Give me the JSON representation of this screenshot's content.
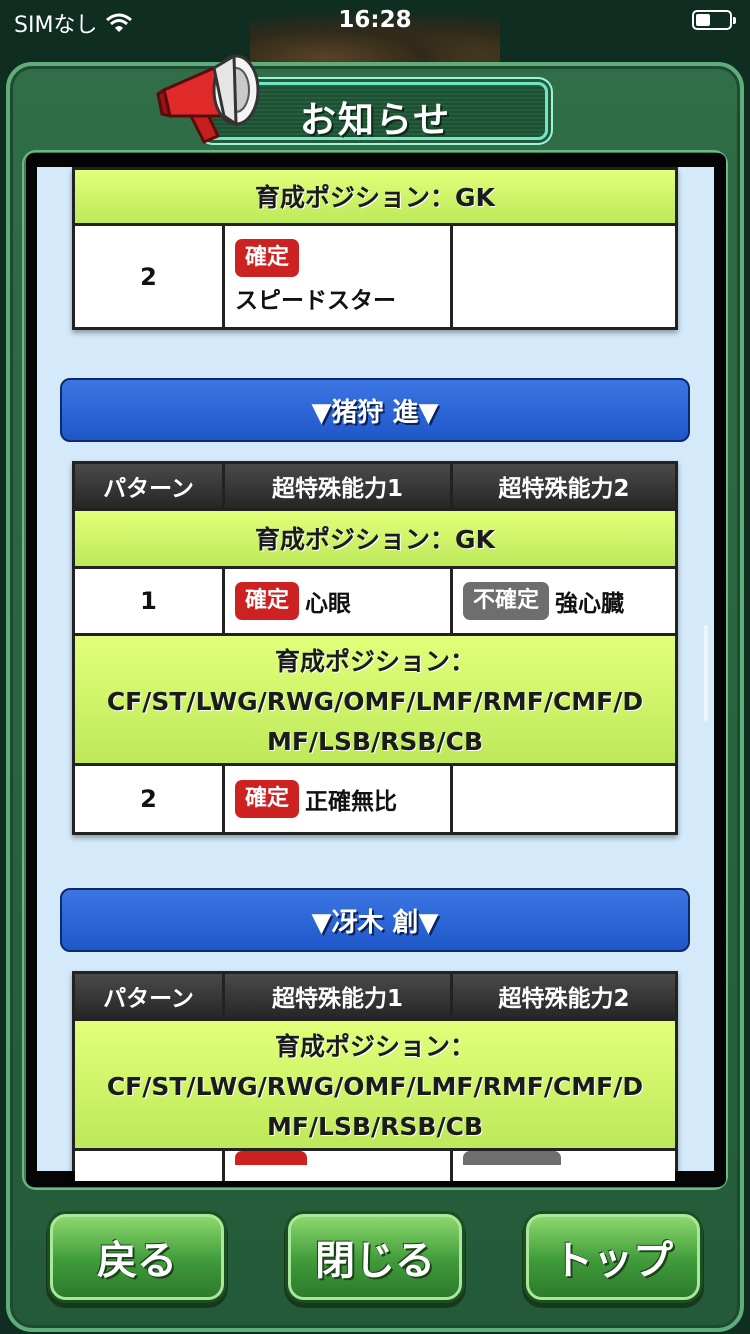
{
  "status_bar": {
    "carrier": "SIMなし",
    "time": "16:28"
  },
  "header": {
    "title": "お知らせ"
  },
  "sections": {
    "top_partial": {
      "position": "育成ポジション：GK",
      "rows": [
        {
          "pattern": "2",
          "badge1": "確定",
          "skill1": "スピードスター"
        }
      ]
    },
    "character1": {
      "name": "▼猪狩 進▼",
      "columns": [
        "パターン",
        "超特殊能力1",
        "超特殊能力2"
      ],
      "position_gk": "育成ポジション：GK",
      "row1": {
        "pattern": "1",
        "badge1": "確定",
        "skill1": "心眼",
        "badge2": "不確定",
        "skill2": "強心臓"
      },
      "position_field_lines": [
        "育成ポジション：",
        "CF/ST/LWG/RWG/OMF/LMF/RMF/CMF/D",
        "MF/LSB/RSB/CB"
      ],
      "row2": {
        "pattern": "2",
        "badge1": "確定",
        "skill1": "正確無比"
      }
    },
    "character2": {
      "name": "▼冴木 創▼",
      "columns": [
        "パターン",
        "超特殊能力1",
        "超特殊能力2"
      ],
      "position_field_lines": [
        "育成ポジション：",
        "CF/ST/LWG/RWG/OMF/LMF/RMF/CMF/D",
        "MF/LSB/RSB/CB"
      ]
    }
  },
  "buttons": {
    "back": "戻る",
    "close": "閉じる",
    "top": "トップ"
  },
  "colors": {
    "accent_green": "#3f9a3a",
    "badge_confirmed": "#cc2222",
    "badge_unconfirmed": "#6e6e6e",
    "name_bar": "#1f57c9",
    "position_bg": "#d4f56a"
  }
}
